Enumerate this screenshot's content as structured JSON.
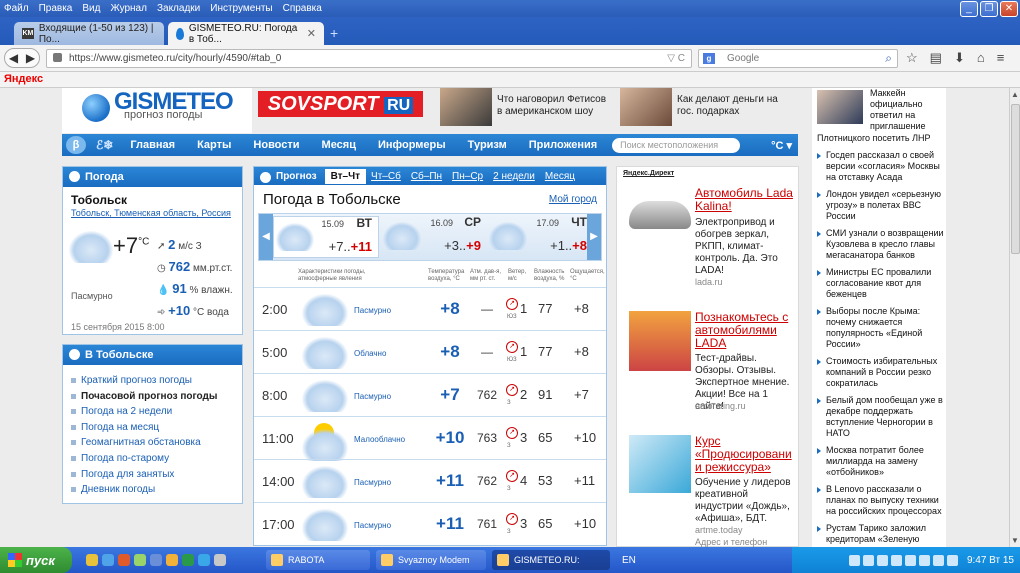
{
  "menubar": {
    "items": [
      "Файл",
      "Правка",
      "Вид",
      "Журнал",
      "Закладки",
      "Инструменты",
      "Справка"
    ]
  },
  "tabs": [
    {
      "title": "Входящие (1-50 из 123) | По...",
      "favicon": "KM"
    },
    {
      "title": "GISMETEO.RU: Погода в Тоб..."
    }
  ],
  "address": {
    "url": "https://www.gismeteo.ru/city/hourly/4590/#tab_0",
    "search_placeholder": "Google"
  },
  "yandex_bar": "Яндекс",
  "header": {
    "logo": "GISMETEO",
    "logo_sub": "прогноз погоды",
    "sovsport": "SOVSPORT",
    "sovsport_tld": "RU",
    "news1": "Что наговорил Фетисов в американском шоу",
    "news2": "Как делают деньги на гос. подарках"
  },
  "topnav": {
    "beta": "β",
    "items": [
      "Главная",
      "Карты",
      "Новости",
      "Месяц",
      "Информеры",
      "Туризм",
      "Приложения"
    ],
    "search_placeholder": "Поиск местоположения",
    "unit": "°С ▾"
  },
  "weather_widget": {
    "title": "Погода",
    "city": "Тобольск",
    "location": "Тобольск, Тюменская область, Россия",
    "temp": "+7",
    "temp_unit": "°С",
    "wind_value": "2",
    "wind_unit": "м/с  З",
    "pressure_value": "762",
    "pressure_unit": "мм.рт.ст.",
    "humidity_value": "91",
    "humidity_unit": "% влажн.",
    "water_value": "+10",
    "water_unit": "°С вода",
    "condition": "Пасмурно",
    "date": "15 сентября 2015 8:00"
  },
  "city_links": {
    "title": "В Тобольске",
    "items": [
      "Краткий прогноз погоды",
      "Почасовой прогноз погоды",
      "Погода на 2 недели",
      "Погода на месяц",
      "Геомагнитная обстановка",
      "Погода по-старому",
      "Погода для занятых",
      "Дневник погоды"
    ],
    "selected_index": 1
  },
  "forecast": {
    "tab_label": "Прогноз",
    "tabs": [
      "Вт–Чт",
      "Чт–Сб",
      "Сб–Пн",
      "Пн–Ср",
      "2 недели",
      "Месяц"
    ],
    "title": "Погода в Тобольске",
    "my_place": "Мой город",
    "days": [
      {
        "date": "15.09",
        "name": "ВТ",
        "min": "+7..",
        "max": "+11"
      },
      {
        "date": "16.09",
        "name": "СР",
        "min": "+3..",
        "max": "+9"
      },
      {
        "date": "17.09",
        "name": "ЧТ",
        "min": "+1..",
        "max": "+8"
      }
    ],
    "columns": {
      "desc": "Характеристики погоды, атмосферные явления",
      "temp": "Температура воздуха, °C",
      "press": "Атм. дав-я, мм рт. ст.",
      "wind": "Ветер, м/с",
      "hum": "Влажность воздуха, %",
      "feel": "Ощущается, °C"
    },
    "rows": [
      {
        "time": "2:00",
        "cond": "Пасмурно",
        "icon": "cloud-icon",
        "temp": "+8",
        "press": "—",
        "wind": "1",
        "wind_dir": "ЮЗ",
        "hum": "77",
        "feel": "+8"
      },
      {
        "time": "5:00",
        "cond": "Облачно",
        "icon": "cloud-icon",
        "temp": "+8",
        "press": "—",
        "wind": "1",
        "wind_dir": "ЮЗ",
        "hum": "77",
        "feel": "+8"
      },
      {
        "time": "8:00",
        "cond": "Пасмурно",
        "icon": "cloud-icon",
        "temp": "+7",
        "press": "762",
        "wind": "2",
        "wind_dir": "З",
        "hum": "91",
        "feel": "+7"
      },
      {
        "time": "11:00",
        "cond": "Малооблачно",
        "icon": "partly-cloudy-icon",
        "temp": "+10",
        "press": "763",
        "wind": "3",
        "wind_dir": "З",
        "hum": "65",
        "feel": "+10"
      },
      {
        "time": "14:00",
        "cond": "Пасмурно",
        "icon": "cloud-icon",
        "temp": "+11",
        "press": "762",
        "wind": "4",
        "wind_dir": "З",
        "hum": "53",
        "feel": "+11"
      },
      {
        "time": "17:00",
        "cond": "Пасмурно",
        "icon": "cloud-icon",
        "temp": "+11",
        "press": "761",
        "wind": "3",
        "wind_dir": "З",
        "hum": "65",
        "feel": "+10"
      }
    ]
  },
  "ads": {
    "header": "Яндекс.Директ",
    "items": [
      {
        "title": "Автомобиль Lada Kalina!",
        "desc": "Электропривод и обогрев зеркал, РКПП, климат-контроль. Да. Это LADA!",
        "url": "lada.ru"
      },
      {
        "title": "Познакомьтесь с автомобилями LADA",
        "desc": "Тест-драйвы. Обзоры. Отзывы. Экспертное мнение. Акции! Все на 1 сайте!",
        "url": "autorating.ru"
      },
      {
        "title": "Курс «Продюсировани и режиссура»",
        "desc": "Обучение у лидеров креативной индустрии «Дождь», «Афиша», БДТ.",
        "url": "artme.today",
        "extra": "Адрес и телефон"
      }
    ]
  },
  "news": {
    "first": "Маккейн официально ответил на приглашение",
    "first2": "Плотницкого посетить ЛНР",
    "items": [
      "Госдеп рассказал о своей версии «согласия» Москвы на отставку Асада",
      "Лондон увидел «серьезную угрозу» в полетах ВВС России",
      "СМИ узнали о возвращении Кузовлева в кресло главы мегасанатора банков",
      "Министры ЕС провалили согласование квот для беженцев",
      "Выборы после Крыма: почему снижается популярность «Единой России»",
      "Стоимость избирательных компаний в России резко сократилась",
      "Белый дом пообещал уже в декабре поддержать вступление Черногории в НАТО",
      "Москва потратит более миллиарда на замену «отбойников»",
      "В Lenovo рассказали о планах по выпуску техники на российских процессорах",
      "Рустам Тарико заложил кредиторам «Зеленую марку» и другие водочные"
    ]
  },
  "taskbar": {
    "start": "пуск",
    "tasks": [
      "RABOTA",
      "Svyaznoy Modem",
      "GISMETEO.RU: Погод..."
    ],
    "lang": "EN",
    "clock": "9:47 Вт 15"
  }
}
